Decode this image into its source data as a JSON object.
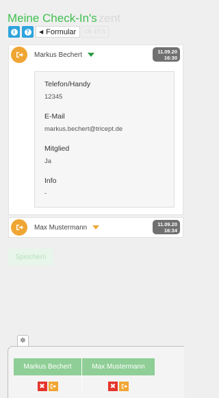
{
  "header": {
    "title": "Meine Check-In's",
    "title_ghost": "zent",
    "formular_label": "Formular",
    "ghost_tab": "ck-In's"
  },
  "checkins": [
    {
      "name": "Markus Bechert",
      "date": "11.09.20",
      "time": "16:30",
      "expanded": true,
      "details": [
        {
          "label": "Telefon/Handy",
          "value": "12345"
        },
        {
          "label": "E-Mail",
          "value": "markus.bechert@tricept.de"
        },
        {
          "label": "Mitglied",
          "value": "Ja"
        },
        {
          "label": "Info",
          "value": "-"
        }
      ]
    },
    {
      "name": "Max Mustermann",
      "date": "11.09.20",
      "time": "16:34",
      "expanded": false
    }
  ],
  "save_label": "Speichern",
  "tray": {
    "people": [
      {
        "name": "Markus Bechert"
      },
      {
        "name": "Max Mustermann"
      }
    ]
  },
  "icons": {
    "info": "info-icon",
    "help": "question-icon",
    "back": "caret-left-icon",
    "checkout": "sign-out-icon",
    "gear": "gear-icon",
    "remove": "close-icon"
  },
  "colors": {
    "accent_green": "#3fbf4f",
    "info_blue": "#2fa4dd",
    "checkout_orange": "#f0a634",
    "remove_red": "#e4352b",
    "badge_gray": "#707070"
  }
}
